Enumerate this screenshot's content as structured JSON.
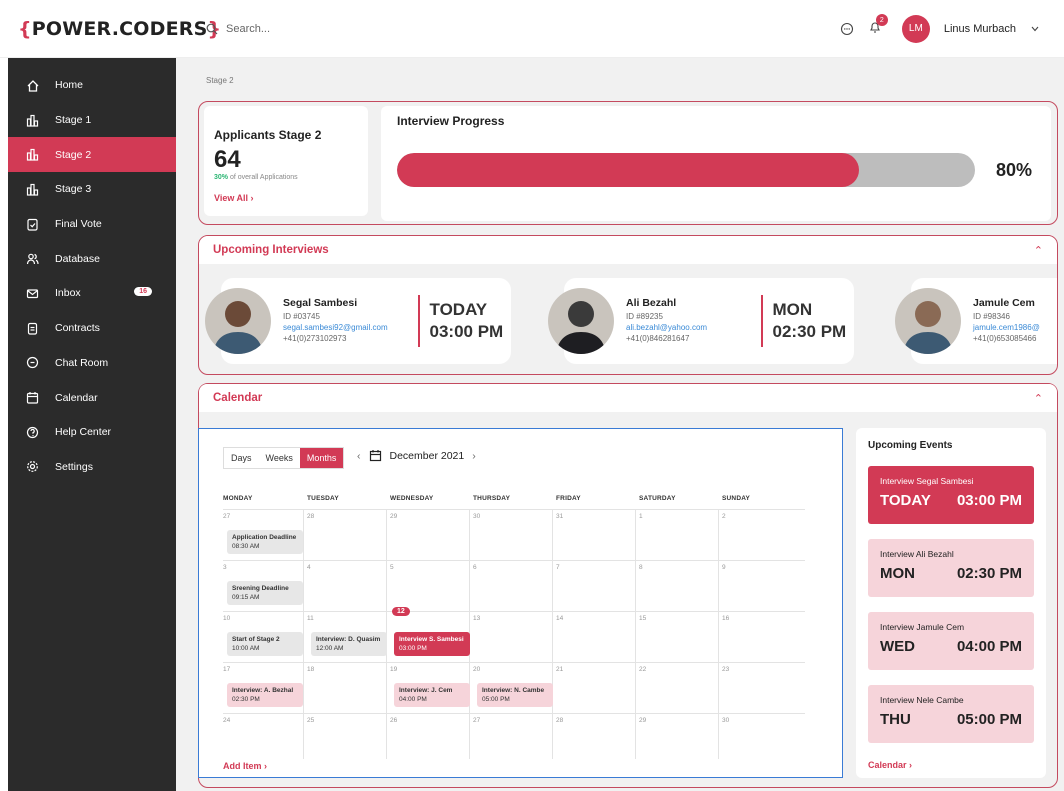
{
  "header": {
    "logo_open": "{",
    "logo_text": "POWER.CODERS",
    "logo_close": "}",
    "search_placeholder": "Search...",
    "notification_count": "2",
    "user_initials": "LM",
    "user_name": "Linus Murbach"
  },
  "sidebar": {
    "items": [
      {
        "label": "Home",
        "icon": "home-icon"
      },
      {
        "label": "Stage 1",
        "icon": "stage-icon"
      },
      {
        "label": "Stage 2",
        "icon": "stage-icon",
        "active": true
      },
      {
        "label": "Stage 3",
        "icon": "stage-icon"
      },
      {
        "label": "Final Vote",
        "icon": "vote-icon"
      },
      {
        "label": "Database",
        "icon": "users-icon"
      },
      {
        "label": "Inbox",
        "icon": "mail-icon",
        "badge": "16"
      },
      {
        "label": "Contracts",
        "icon": "document-icon"
      },
      {
        "label": "Chat Room",
        "icon": "chat-icon"
      },
      {
        "label": "Calendar",
        "icon": "calendar-icon"
      },
      {
        "label": "Help Center",
        "icon": "help-icon"
      },
      {
        "label": "Settings",
        "icon": "gear-icon"
      }
    ]
  },
  "breadcrumb": "Stage 2",
  "applicants": {
    "title": "Applicants Stage 2",
    "count": "64",
    "percent": "30%",
    "percent_label": " of overall Applications",
    "link": "View All"
  },
  "progress": {
    "title": "Interview Progress",
    "value": 80,
    "label": "80%"
  },
  "interviews": {
    "title": "Upcoming Interviews",
    "items": [
      {
        "name": "Segal Sambesi",
        "id": "ID #03745",
        "email": "segal.sambesi92@gmail.com",
        "phone": "+41(0)273102973",
        "day": "TODAY",
        "time": "03:00 PM"
      },
      {
        "name": "Ali Bezahl",
        "id": "ID #89235",
        "email": "ali.bezahl@yahoo.com",
        "phone": "+41(0)846281647",
        "day": "MON",
        "time": "02:30 PM"
      },
      {
        "name": "Jamule Cem",
        "id": "ID #98346",
        "email": "jamule.cem1986@",
        "phone": "+41(0)653085466",
        "day": "",
        "time": ""
      }
    ]
  },
  "calendar": {
    "title": "Calendar",
    "views": [
      "Days",
      "Weeks",
      "Months"
    ],
    "month": "December 2021",
    "days": [
      "MONDAY",
      "TUESDAY",
      "WEDNESDAY",
      "THURSDAY",
      "FRIDAY",
      "SATURDAY",
      "SUNDAY"
    ],
    "weeks": [
      [
        "27",
        "28",
        "29",
        "30",
        "31",
        "1",
        "2"
      ],
      [
        "3",
        "4",
        "5",
        "6",
        "7",
        "8",
        "9"
      ],
      [
        "10",
        "11",
        "12",
        "13",
        "14",
        "15",
        "16"
      ],
      [
        "17",
        "18",
        "19",
        "20",
        "21",
        "22",
        "23"
      ],
      [
        "24",
        "25",
        "26",
        "27",
        "28",
        "29",
        "30"
      ]
    ],
    "events": {
      "e1": {
        "title": "Application Deadline",
        "time": "08:30 AM"
      },
      "e2": {
        "title": "Sreening Deadline",
        "time": "09:15 AM"
      },
      "e3": {
        "title": "Start of Stage 2",
        "time": "10:00 AM"
      },
      "e4": {
        "title": "Interview: D. Quasim",
        "time": "12:00 AM"
      },
      "e5": {
        "title": "Interview S. Sambesi",
        "time": "03:00 PM"
      },
      "e6": {
        "title": "Interview: A. Bezhal",
        "time": "02:30 PM"
      },
      "e7": {
        "title": "Interview: J. Cem",
        "time": "04:00 PM"
      },
      "e8": {
        "title": "Interview: N. Cambe",
        "time": "05:00 PM"
      }
    },
    "add_item": "Add Item"
  },
  "upcoming_events": {
    "title": "Upcoming Events",
    "items": [
      {
        "title": "Interview Segal Sambesi",
        "day": "TODAY",
        "time": "03:00 PM"
      },
      {
        "title": "Interview Ali Bezahl",
        "day": "MON",
        "time": "02:30 PM"
      },
      {
        "title": "Interview Jamule Cem",
        "day": "WED",
        "time": "04:00 PM"
      },
      {
        "title": "Interview Nele Cambe",
        "day": "THU",
        "time": "05:00 PM"
      }
    ],
    "link": "Calendar"
  },
  "colors": {
    "accent": "#d23a55",
    "sidebar": "#2b2b2b",
    "event_pink": "#f6d4da"
  }
}
